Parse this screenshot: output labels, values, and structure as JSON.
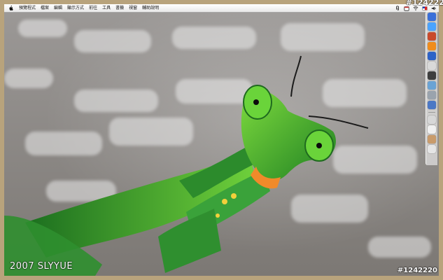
{
  "menubar": {
    "items": [
      "預覽程式",
      "檔案",
      "編輯",
      "顯示方式",
      "前往",
      "工具",
      "書籤",
      "視窗",
      "輔助說明"
    ],
    "extras": [
      {
        "icon": "paperclip-icon"
      },
      {
        "icon": "calendar-icon"
      },
      {
        "icon": "wifi-icon"
      },
      {
        "icon": "flag-icon"
      },
      {
        "icon": "volume-icon"
      }
    ]
  },
  "badges": {
    "top": "#124222",
    "bottom": "#1242220"
  },
  "watermark": {
    "text": "2007 SLYYUE"
  },
  "dock": {
    "icons": [
      {
        "icon": "finder-icon",
        "color": "#3a6fd8"
      },
      {
        "icon": "safari-icon",
        "color": "#4aa3ff"
      },
      {
        "icon": "mail-icon",
        "color": "#c94a2c"
      },
      {
        "icon": "firefox-icon",
        "color": "#f08c1c"
      },
      {
        "icon": "itunes-icon",
        "color": "#2d62c7"
      },
      {
        "icon": "chat-icon",
        "color": "#d9d9d9"
      },
      {
        "icon": "camera-icon",
        "color": "#3e3e3e"
      },
      {
        "icon": "preview-icon",
        "color": "#6aa3d5"
      },
      {
        "icon": "tools-icon",
        "color": "#9aa3ad"
      },
      {
        "icon": "world-icon",
        "color": "#4c78c5"
      },
      {
        "icon": "disk-icon",
        "color": "#d7d7d7"
      },
      {
        "icon": "speaker-icon",
        "color": "#f0f0f0"
      },
      {
        "icon": "photo-icon",
        "color": "#c99b6b"
      },
      {
        "icon": "trash-icon",
        "color": "#e5e5e5"
      }
    ]
  }
}
